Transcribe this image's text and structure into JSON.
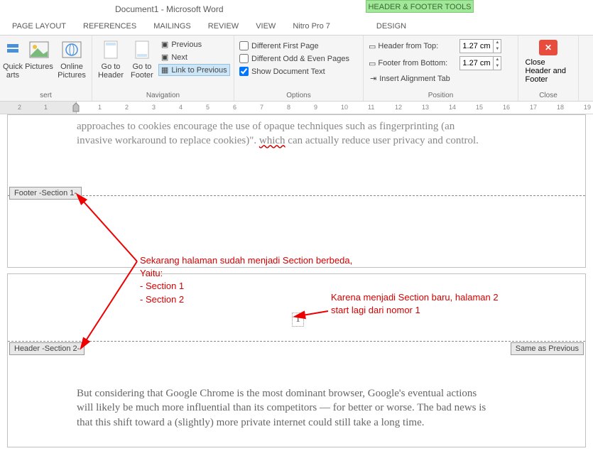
{
  "title": "Document1 - Microsoft Word",
  "context_tab": "HEADER & FOOTER TOOLS",
  "tabs": [
    "PAGE LAYOUT",
    "REFERENCES",
    "MAILINGS",
    "REVIEW",
    "VIEW",
    "Nitro Pro 7",
    "DESIGN"
  ],
  "ribbon": {
    "insert": {
      "label": "sert",
      "quick": "Quick arts",
      "pictures": "Pictures",
      "online": "Online Pictures"
    },
    "nav": {
      "label": "Navigation",
      "goto_header": "Go to Header",
      "goto_footer": "Go to Footer",
      "previous": "Previous",
      "next": "Next",
      "link": "Link to Previous"
    },
    "options": {
      "label": "Options",
      "diff_first": "Different First Page",
      "diff_odd": "Different Odd & Even Pages",
      "show_doc": "Show Document Text"
    },
    "position": {
      "label": "Position",
      "header_from_top": "Header from Top:",
      "footer_from_bottom": "Footer from Bottom:",
      "insert_align": "Insert Alignment Tab",
      "val_top": "1.27 cm",
      "val_bot": "1.27 cm"
    },
    "close": {
      "label": "Close",
      "btn": "Close Header and Footer"
    }
  },
  "ruler_numbers_left": [
    "2",
    "1"
  ],
  "ruler_numbers": [
    "1",
    "2",
    "3",
    "4",
    "5",
    "6",
    "7",
    "8",
    "9",
    "10",
    "11",
    "12",
    "13",
    "14",
    "15",
    "16",
    "17",
    "18",
    "19"
  ],
  "doc": {
    "page1_text_l1_a": "approaches to cookies encourage the use of opaque techniques such as fingerprinting (an",
    "page1_text_l2_a": "invasive workaround to replace cookies)\". ",
    "page1_text_l2_word": "which",
    "page1_text_l2_b": " can actually reduce user privacy and control.",
    "footer_label": "Footer -Section 1-",
    "header_label": "Header -Section 2-",
    "same_prev": "Same as Previous",
    "page_number": "1",
    "page2_text_l1": "But considering that Google Chrome is the most dominant browser, Google's eventual actions",
    "page2_text_l2": "will likely be much more influential than its competitors — for better or worse. The bad news is",
    "page2_text_l3": "that this shift toward a (slightly) more private internet could still take a long time."
  },
  "annots": {
    "a1_l1": "Sekarang halaman sudah menjadi Section berbeda,",
    "a1_l2": "Yaitu:",
    "a1_l3": "- Section 1",
    "a1_l4": "- Section 2",
    "a2_l1": "Karena menjadi Section baru, halaman 2",
    "a2_l2": "start lagi dari nomor 1"
  }
}
